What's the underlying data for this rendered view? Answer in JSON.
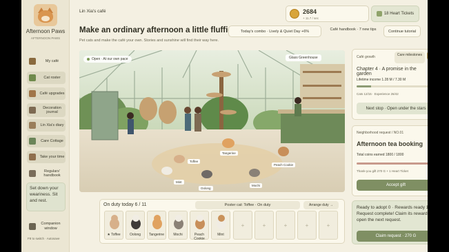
{
  "colors": {
    "accent": "#7f8f63",
    "panel": "#fbf8ec",
    "background": "#f4f0e2"
  },
  "sidebar": {
    "brand": "Afternoon Paws",
    "brand_sub": "AFTERNOON PAWS",
    "items": [
      {
        "label": "My café",
        "icon": "cafe-icon"
      },
      {
        "label": "Cat roster",
        "icon": "cat-icon"
      },
      {
        "label": "Café upgrades",
        "icon": "upgrade-icon"
      },
      {
        "label": "Decoration journal",
        "icon": "decoration-icon"
      },
      {
        "label": "Lin Xia's diary",
        "icon": "diary-icon"
      },
      {
        "label": "Care Cottage",
        "icon": "cottage-icon"
      },
      {
        "label": "Take your time",
        "icon": "clock-icon"
      },
      {
        "label": "Regulars' handbook",
        "icon": "handbook-icon"
      }
    ],
    "note": "Set down your weariness. Sit and rest.",
    "companion": "Companion window",
    "fkey_hint": "F8 to switch · Autosave"
  },
  "header": {
    "owner": "Lin Xia's café",
    "headline": "Make an ordinary afternoon a little fluffier.",
    "subline": "Pet cats and make the café your own. Stories and sunshine will find their way here.",
    "coins": "2684",
    "coin_rate": "+ 11.7 / sec",
    "tickets": "18 Heart Tickets",
    "combo": "Today's combo · Lively & Quiet Day +6%",
    "handbook": "Café handbook · 7 new tips",
    "continue": "Continue tutorial"
  },
  "scene": {
    "open_badge": "Open · At our own pace",
    "location": "Glass Greenhouse",
    "cats": [
      "Tangerine",
      "Toffee",
      "Peach Cookie",
      "Mint",
      "Oolong",
      "Mochi"
    ]
  },
  "duty": {
    "title": "On duty today 6 / 11",
    "poster": "Poster cat: Toffee · On duty",
    "arrange": "Arrange duty →",
    "slots": [
      "★ Toffee",
      "Oolong",
      "Tangerine",
      "Mochi",
      "Peach Cookie",
      "Mint"
    ],
    "empty_slots": 5,
    "empty_symbol": "+"
  },
  "growth": {
    "label": "Café growth",
    "milestones": "Care milestones",
    "chapter": "Chapter 4 · A promise in the garden",
    "lifetime": "Lifetime income 1.28 M / 7.30 M",
    "lifetime_progress": 0.18,
    "cats_exp": "Cats 12/15 · Experience 26/42",
    "next": "Next stop · Open under the stars"
  },
  "request": {
    "label": "Neighborhood request / NO.01",
    "title": "Afternoon tea booking",
    "coins_earned": "Total coins earned 1800 / 1800",
    "progress": 1.0,
    "thanks": "Thank-you gift 270 G + 1 Heart Ticket",
    "accept": "Accept gift"
  },
  "adopt": {
    "text": "Ready to adopt 0 · Rewards ready 1 Request complete! Claim its reward to open the next request.",
    "claim": "Claim request · 270 G"
  }
}
